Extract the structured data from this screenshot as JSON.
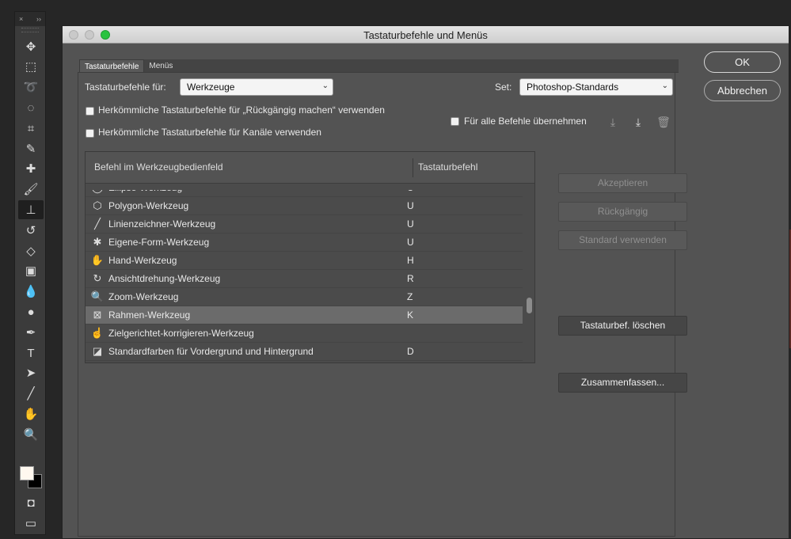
{
  "toolbar": {
    "header_close": "×",
    "header_collapse": "››",
    "tools": [
      {
        "name": "move-tool-icon",
        "glyph": "✥"
      },
      {
        "name": "marquee-tool-icon",
        "glyph": "⬚"
      },
      {
        "name": "lasso-tool-icon",
        "glyph": "➰"
      },
      {
        "name": "quick-selection-tool-icon",
        "glyph": "◌"
      },
      {
        "name": "crop-tool-icon",
        "glyph": "⌗"
      },
      {
        "name": "eyedropper-tool-icon",
        "glyph": "✎"
      },
      {
        "name": "healing-brush-tool-icon",
        "glyph": "✚"
      },
      {
        "name": "brush-tool-icon",
        "glyph": "🖌"
      },
      {
        "name": "clone-stamp-tool-icon",
        "glyph": "⊥"
      },
      {
        "name": "history-brush-tool-icon",
        "glyph": "↺"
      },
      {
        "name": "eraser-tool-icon",
        "glyph": "◇"
      },
      {
        "name": "gradient-tool-icon",
        "glyph": "▣"
      },
      {
        "name": "blur-tool-icon",
        "glyph": "💧"
      },
      {
        "name": "dodge-tool-icon",
        "glyph": "●"
      },
      {
        "name": "pen-tool-icon",
        "glyph": "✒"
      },
      {
        "name": "type-tool-icon",
        "glyph": "T"
      },
      {
        "name": "path-selection-tool-icon",
        "glyph": "➤"
      },
      {
        "name": "line-tool-icon",
        "glyph": "╱"
      },
      {
        "name": "hand-tool-icon",
        "glyph": "✋"
      },
      {
        "name": "zoom-tool-icon",
        "glyph": "🔍"
      }
    ],
    "bottom_tools": [
      {
        "name": "quick-mask-icon",
        "glyph": "◘"
      },
      {
        "name": "screen-mode-icon",
        "glyph": "▭"
      }
    ]
  },
  "window": {
    "title": "Tastaturbefehle und Menüs"
  },
  "tabs": [
    {
      "label": "Tastaturbefehle",
      "active": true
    },
    {
      "label": "Menüs",
      "active": false
    }
  ],
  "form": {
    "shortcuts_for_label": "Tastaturbefehle für:",
    "shortcuts_for_value": "Werkzeuge",
    "set_label": "Set:",
    "set_value": "Photoshop-Standards",
    "legacy_undo_label": "Herkömmliche Tastaturbefehle für „Rückgängig machen“ verwenden",
    "legacy_channel_label": "Herkömmliche Tastaturbefehle für Kanäle verwenden",
    "apply_all_label": "Für alle Befehle übernehmen"
  },
  "table": {
    "col_command": "Befehl im Werkzeugbedienfeld",
    "col_shortcut": "Tastaturbefehl",
    "rows": [
      {
        "icon": "ellipse-tool-icon",
        "glyph": "◯",
        "name": "Ellipse-Werkzeug",
        "key": "U"
      },
      {
        "icon": "polygon-tool-icon",
        "glyph": "⬡",
        "name": "Polygon-Werkzeug",
        "key": "U"
      },
      {
        "icon": "line-tool-icon",
        "glyph": "╱",
        "name": "Linienzeichner-Werkzeug",
        "key": "U"
      },
      {
        "icon": "custom-shape-tool-icon",
        "glyph": "✱",
        "name": "Eigene-Form-Werkzeug",
        "key": "U"
      },
      {
        "icon": "hand-tool-icon",
        "glyph": "✋",
        "name": "Hand-Werkzeug",
        "key": "H"
      },
      {
        "icon": "rotate-view-tool-icon",
        "glyph": "↻",
        "name": "Ansichtdrehung-Werkzeug",
        "key": "R"
      },
      {
        "icon": "zoom-tool-icon",
        "glyph": "🔍",
        "name": "Zoom-Werkzeug",
        "key": "Z"
      },
      {
        "icon": "frame-tool-icon",
        "glyph": "⊠",
        "name": "Rahmen-Werkzeug",
        "key": "K",
        "selected": true
      },
      {
        "icon": "targeted-adjustment-tool-icon",
        "glyph": "☝",
        "name": "Zielgerichtet-korrigieren-Werkzeug",
        "key": ""
      },
      {
        "icon": "default-colors-icon",
        "glyph": "◪",
        "name": "Standardfarben für Vordergrund und Hintergrund",
        "key": "D"
      }
    ]
  },
  "actions": {
    "accept": "Akzeptieren",
    "undo": "Rückgängig",
    "use_default": "Standard verwenden",
    "delete_shortcut": "Tastaturbef. löschen",
    "summarize": "Zusammenfassen..."
  },
  "dialog_buttons": {
    "ok": "OK",
    "cancel": "Abbrechen"
  }
}
